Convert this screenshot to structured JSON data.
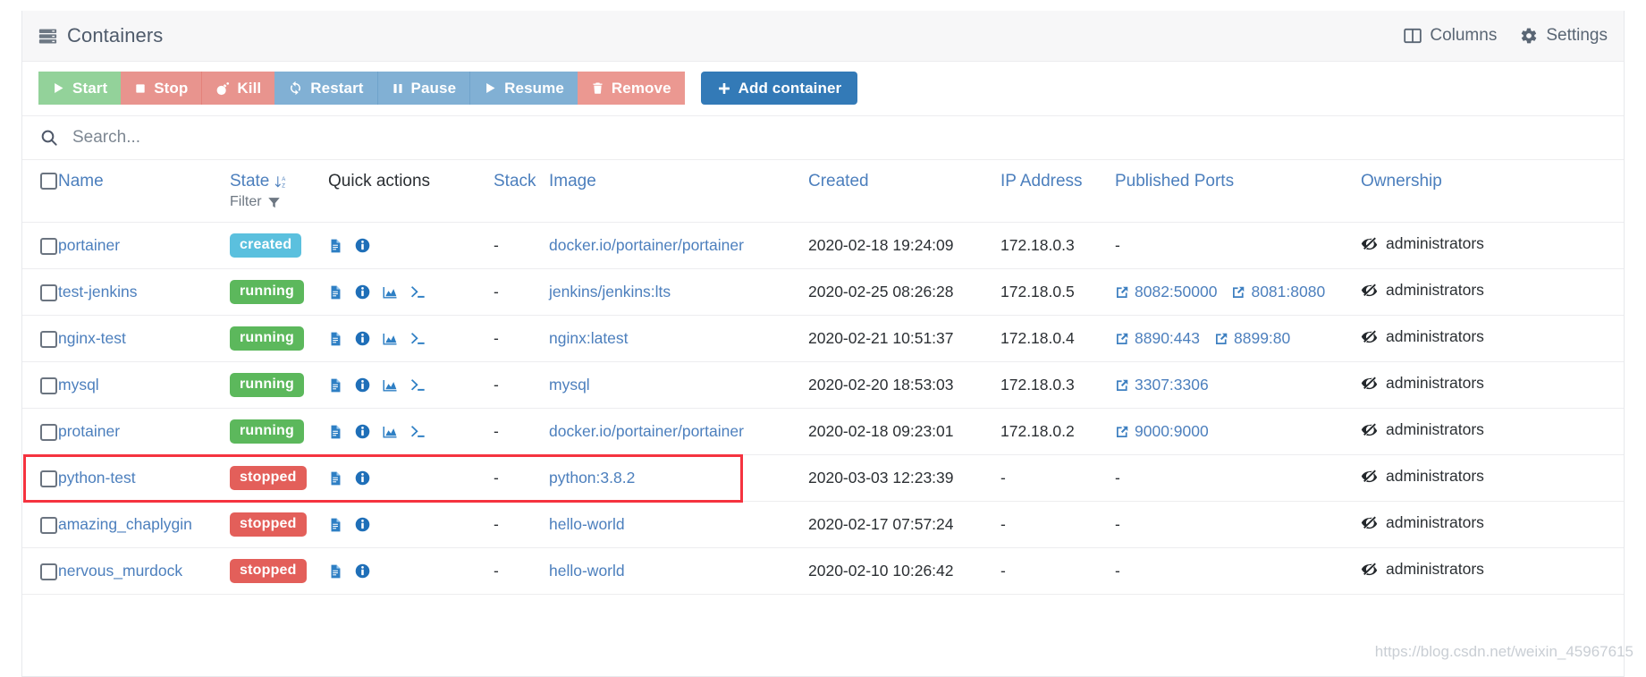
{
  "header": {
    "title": "Containers",
    "title_icon": "server-stack-icon",
    "columns_label": "Columns",
    "columns_icon": "columns-icon",
    "settings_label": "Settings",
    "settings_icon": "gear-icon"
  },
  "toolbar": {
    "buttons": [
      {
        "label": "Start",
        "icon": "play-icon",
        "style": "green"
      },
      {
        "label": "Stop",
        "icon": "stop-icon",
        "style": "red"
      },
      {
        "label": "Kill",
        "icon": "bomb-icon",
        "style": "redsep"
      },
      {
        "label": "Restart",
        "icon": "refresh-icon",
        "style": "blue"
      },
      {
        "label": "Pause",
        "icon": "pause-icon",
        "style": "bluesep"
      },
      {
        "label": "Resume",
        "icon": "play-icon",
        "style": "bluesep"
      },
      {
        "label": "Remove",
        "icon": "trash-icon",
        "style": "salmon"
      }
    ],
    "add_label": "Add container",
    "add_icon": "plus-icon"
  },
  "search": {
    "placeholder": "Search...",
    "value": "",
    "icon": "search-icon"
  },
  "table": {
    "headers": {
      "name": "Name",
      "state": "State",
      "state_sort_icon": "sort-alpha-down-icon",
      "filter": "Filter",
      "filter_icon": "funnel-icon",
      "quick_actions": "Quick actions",
      "stack": "Stack",
      "image": "Image",
      "created": "Created",
      "ip_address": "IP Address",
      "published_ports": "Published Ports",
      "ownership": "Ownership"
    },
    "state_colors": {
      "created": "#5bc0de",
      "running": "#5cb85c",
      "stopped": "#e35f5a"
    },
    "icons": {
      "logs": "file-lines-icon",
      "inspect": "info-circle-icon",
      "stats": "chart-area-icon",
      "console": "terminal-icon",
      "port_link": "external-link-icon",
      "ownership": "eye-slash-icon"
    },
    "rows": [
      {
        "name": "portainer",
        "state": "created",
        "quick_actions": [
          "logs",
          "inspect"
        ],
        "stack": "-",
        "image": "docker.io/portainer/portainer",
        "created": "2020-02-18 19:24:09",
        "ip": "172.18.0.3",
        "ports": [],
        "ports_empty": "-",
        "ownership": "administrators",
        "highlighted": false
      },
      {
        "name": "test-jenkins",
        "state": "running",
        "quick_actions": [
          "logs",
          "inspect",
          "stats",
          "console"
        ],
        "stack": "-",
        "image": "jenkins/jenkins:lts",
        "created": "2020-02-25 08:26:28",
        "ip": "172.18.0.5",
        "ports": [
          "8082:50000",
          "8081:8080"
        ],
        "ports_empty": "",
        "ownership": "administrators",
        "highlighted": false
      },
      {
        "name": "nginx-test",
        "state": "running",
        "quick_actions": [
          "logs",
          "inspect",
          "stats",
          "console"
        ],
        "stack": "-",
        "image": "nginx:latest",
        "created": "2020-02-21 10:51:37",
        "ip": "172.18.0.4",
        "ports": [
          "8890:443",
          "8899:80"
        ],
        "ports_empty": "",
        "ownership": "administrators",
        "highlighted": false
      },
      {
        "name": "mysql",
        "state": "running",
        "quick_actions": [
          "logs",
          "inspect",
          "stats",
          "console"
        ],
        "stack": "-",
        "image": "mysql",
        "created": "2020-02-20 18:53:03",
        "ip": "172.18.0.3",
        "ports": [
          "3307:3306"
        ],
        "ports_empty": "",
        "ownership": "administrators",
        "highlighted": false
      },
      {
        "name": "protainer",
        "state": "running",
        "quick_actions": [
          "logs",
          "inspect",
          "stats",
          "console"
        ],
        "stack": "-",
        "image": "docker.io/portainer/portainer",
        "created": "2020-02-18 09:23:01",
        "ip": "172.18.0.2",
        "ports": [
          "9000:9000"
        ],
        "ports_empty": "",
        "ownership": "administrators",
        "highlighted": false
      },
      {
        "name": "python-test",
        "state": "stopped",
        "quick_actions": [
          "logs",
          "inspect"
        ],
        "stack": "-",
        "image": "python:3.8.2",
        "created": "2020-03-03 12:23:39",
        "ip": "-",
        "ports": [],
        "ports_empty": "-",
        "ownership": "administrators",
        "highlighted": true
      },
      {
        "name": "amazing_chaplygin",
        "state": "stopped",
        "quick_actions": [
          "logs",
          "inspect"
        ],
        "stack": "-",
        "image": "hello-world",
        "created": "2020-02-17 07:57:24",
        "ip": "-",
        "ports": [],
        "ports_empty": "-",
        "ownership": "administrators",
        "highlighted": false
      },
      {
        "name": "nervous_murdock",
        "state": "stopped",
        "quick_actions": [
          "logs",
          "inspect"
        ],
        "stack": "-",
        "image": "hello-world",
        "created": "2020-02-10 10:26:42",
        "ip": "-",
        "ports": [],
        "ports_empty": "-",
        "ownership": "administrators",
        "highlighted": false
      }
    ]
  },
  "watermark": "https://blog.csdn.net/weixin_45967615"
}
